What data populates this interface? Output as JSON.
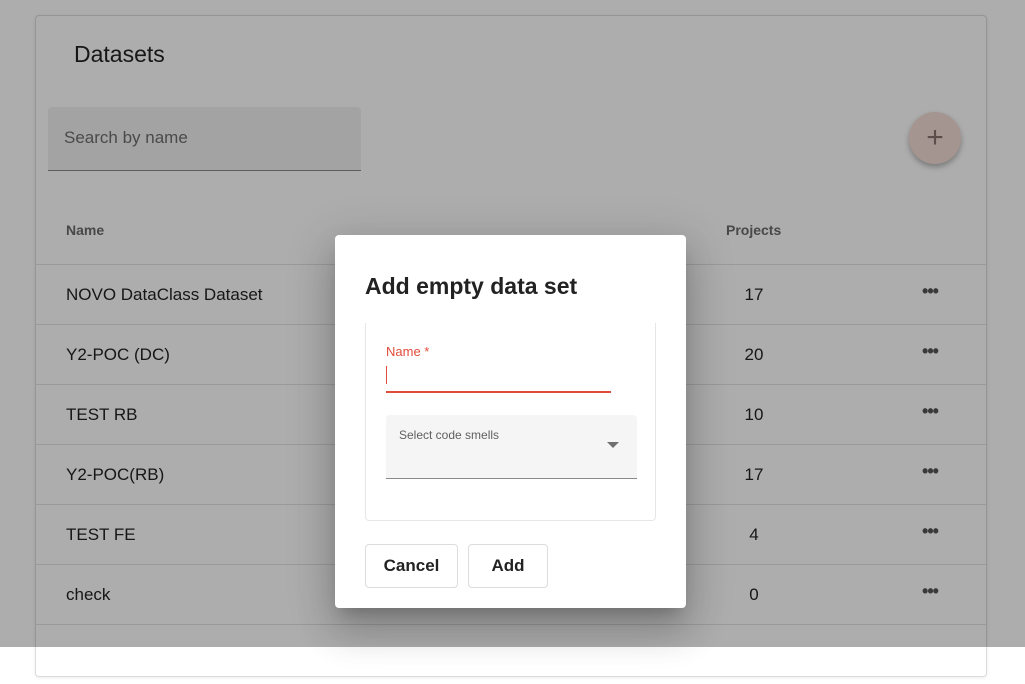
{
  "page": {
    "title": "Datasets",
    "search": {
      "placeholder": "Search by name",
      "value": ""
    },
    "add_button": {
      "icon": "plus-icon",
      "glyph": "+"
    },
    "table": {
      "columns": [
        "Name",
        "Projects"
      ],
      "row_menu_glyph": "•••",
      "rows": [
        {
          "name": "NOVO DataClass Dataset",
          "projects": "17"
        },
        {
          "name": "Y2-POC (DC)",
          "projects": "20"
        },
        {
          "name": "TEST RB",
          "projects": "10"
        },
        {
          "name": "Y2-POC(RB)",
          "projects": "17"
        },
        {
          "name": "TEST FE",
          "projects": "4"
        },
        {
          "name": "check",
          "projects": "0"
        }
      ]
    }
  },
  "dialog": {
    "title": "Add empty data set",
    "name_field": {
      "label": "Name *",
      "value": ""
    },
    "code_smells_select": {
      "label": "Select code smells",
      "value": ""
    },
    "cancel_label": "Cancel",
    "add_label": "Add"
  },
  "colors": {
    "accent_error": "#e04b3c",
    "fab_background": "#f3dcd6",
    "backdrop": "rgba(0,0,0,0.32)"
  }
}
